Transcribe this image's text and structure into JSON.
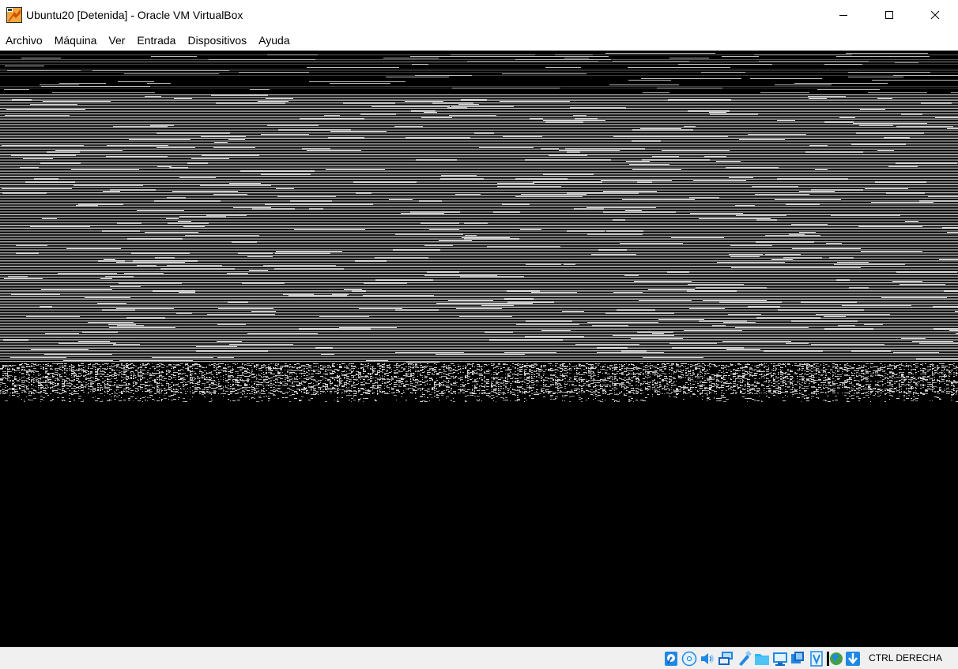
{
  "window": {
    "title": "Ubuntu20 [Detenida] - Oracle VM VirtualBox",
    "app_icon": "virtualbox-icon",
    "controls": {
      "minimize_icon": "minimize-icon",
      "maximize_icon": "maximize-icon",
      "close_icon": "close-icon"
    }
  },
  "menubar": {
    "items": [
      {
        "label": "Archivo"
      },
      {
        "label": "Máquina"
      },
      {
        "label": "Ver"
      },
      {
        "label": "Entrada"
      },
      {
        "label": "Dispositivos"
      },
      {
        "label": "Ayuda"
      }
    ]
  },
  "vm_screen": {
    "state": "corrupted-display-noise"
  },
  "statusbar": {
    "icons": [
      "hard-disk-icon",
      "optical-drive-icon",
      "audio-icon",
      "network-icon",
      "usb-icon",
      "shared-folders-icon",
      "display-icon",
      "recording-icon",
      "virtualization-icon",
      "mouse-integration-icon",
      "keyboard-capture-icon"
    ],
    "host_key": "CTRL DERECHA"
  },
  "colors": {
    "accent_blue": "#1e88e5",
    "screen_bg": "#000000",
    "statusbar_bg": "#f0f0f0"
  }
}
